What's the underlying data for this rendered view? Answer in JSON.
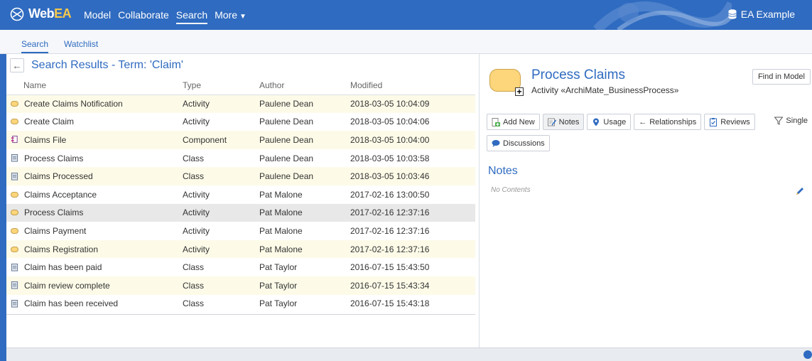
{
  "header": {
    "brand_prefix": "Web",
    "brand_suffix": "EA",
    "nav": [
      {
        "label": "Model"
      },
      {
        "label": "Collaborate"
      },
      {
        "label": "Search"
      },
      {
        "label": "More"
      }
    ],
    "model_name": "EA Example"
  },
  "subnav": {
    "tabs": [
      {
        "label": "Search"
      },
      {
        "label": "Watchlist"
      }
    ]
  },
  "results": {
    "title": "Search Results - Term: 'Claim'",
    "columns": [
      "Name",
      "Type",
      "Author",
      "Modified"
    ],
    "rows": [
      {
        "name": "Create Claims Notification",
        "type": "Activity",
        "author": "Paulene Dean",
        "modified": "2018-03-05 10:04:09",
        "icon": "activity-icon"
      },
      {
        "name": "Create Claim",
        "type": "Activity",
        "author": "Paulene Dean",
        "modified": "2018-03-05 10:04:06",
        "icon": "activity-icon"
      },
      {
        "name": "Claims File",
        "type": "Component",
        "author": "Paulene Dean",
        "modified": "2018-03-05 10:04:00",
        "icon": "component-icon"
      },
      {
        "name": "Process Claims",
        "type": "Class",
        "author": "Paulene Dean",
        "modified": "2018-03-05 10:03:58",
        "icon": "class-icon"
      },
      {
        "name": "Claims Processed",
        "type": "Class",
        "author": "Paulene Dean",
        "modified": "2018-03-05 10:03:46",
        "icon": "class-icon"
      },
      {
        "name": "Claims Acceptance",
        "type": "Activity",
        "author": "Pat Malone",
        "modified": "2017-02-16 13:00:50",
        "icon": "activity-icon"
      },
      {
        "name": "Process Claims",
        "type": "Activity",
        "author": "Pat Malone",
        "modified": "2017-02-16 12:37:16",
        "icon": "activity-icon"
      },
      {
        "name": "Claims Payment",
        "type": "Activity",
        "author": "Pat Malone",
        "modified": "2017-02-16 12:37:16",
        "icon": "activity-icon"
      },
      {
        "name": "Claims Registration",
        "type": "Activity",
        "author": "Pat Malone",
        "modified": "2017-02-16 12:37:16",
        "icon": "activity-icon"
      },
      {
        "name": "Claim has been paid",
        "type": "Class",
        "author": "Pat Taylor",
        "modified": "2016-07-15 15:43:50",
        "icon": "class-icon"
      },
      {
        "name": "Claim review complete",
        "type": "Class",
        "author": "Pat Taylor",
        "modified": "2016-07-15 15:43:34",
        "icon": "class-icon"
      },
      {
        "name": "Claim has been received",
        "type": "Class",
        "author": "Pat Taylor",
        "modified": "2016-07-15 15:43:18",
        "icon": "class-icon"
      }
    ]
  },
  "properties": {
    "element_name": "Process Claims",
    "element_type": "Activity «ArchiMate_BusinessProcess»",
    "find_in_model": "Find in Model",
    "buttons": {
      "add_new": "Add New",
      "notes": "Notes",
      "usage": "Usage",
      "relationships": "Relationships",
      "reviews": "Reviews",
      "single": "Single",
      "discussions": "Discussions"
    },
    "notes_title": "Notes",
    "notes_content": "No Contents"
  },
  "colors": {
    "brand": "#2f6bc0",
    "activity": "#fdd57a",
    "row_alt": "#fdfbe8",
    "row_selected": "#e8e8e8"
  }
}
